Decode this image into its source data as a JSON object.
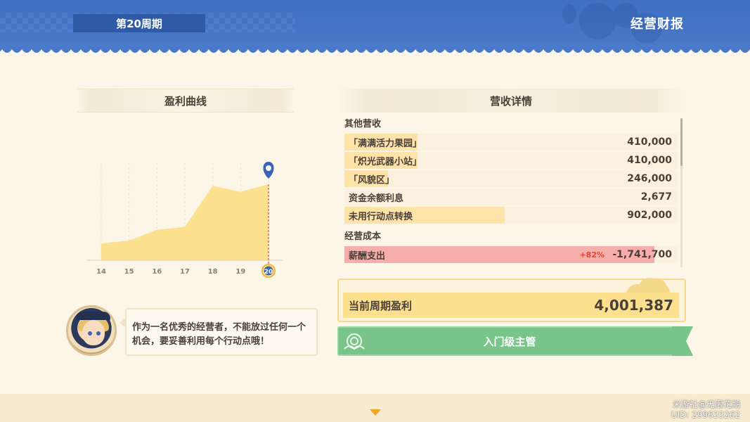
{
  "header": {
    "period": "第20周期",
    "title": "经营财报"
  },
  "profit_curve": {
    "title": "盈利曲线"
  },
  "chart_data": {
    "type": "area",
    "title": "盈利曲线",
    "x": [
      14,
      15,
      16,
      17,
      18,
      19,
      20
    ],
    "categories": [
      "14",
      "15",
      "16",
      "17",
      "18",
      "19",
      "20"
    ],
    "values": [
      0.22,
      0.26,
      0.4,
      0.44,
      0.98,
      0.9,
      1.0
    ],
    "current": "20",
    "colors": {
      "fill": "#fde08e",
      "marker": "#3a64b8",
      "current_line": "#e0504a"
    },
    "grid": true
  },
  "revenue": {
    "title": "营收详情",
    "groups": [
      {
        "title": "其他营收",
        "rows": [
          {
            "label": "「满满活力果园」",
            "value": "410,000",
            "fill": 0.22
          },
          {
            "label": "「炽光武器小站」",
            "value": "410,000",
            "fill": 0.22
          },
          {
            "label": "「风貌区」",
            "value": "246,000",
            "fill": 0.13
          },
          {
            "label": "资金余额利息",
            "value": "2,677",
            "fill": 0.0
          },
          {
            "label": "未用行动点转换",
            "value": "902,000",
            "fill": 0.48
          }
        ]
      },
      {
        "title": "经营成本",
        "rows": [
          {
            "label": "薪酬支出",
            "value": "-1,741,700",
            "pct": "+82%",
            "fill": 0.93,
            "negative": true
          }
        ]
      }
    ]
  },
  "profit": {
    "label": "当前周期盈利",
    "value": "4,001,387"
  },
  "rank": {
    "label": "入门级主管"
  },
  "dialogue": {
    "text": "作为一名优秀的经营者，不能放过任何一个机会，要妥善利用每个行动点哦！"
  },
  "watermark": {
    "line1": "米游社@无限花期",
    "line2": "UID: 299633262"
  }
}
